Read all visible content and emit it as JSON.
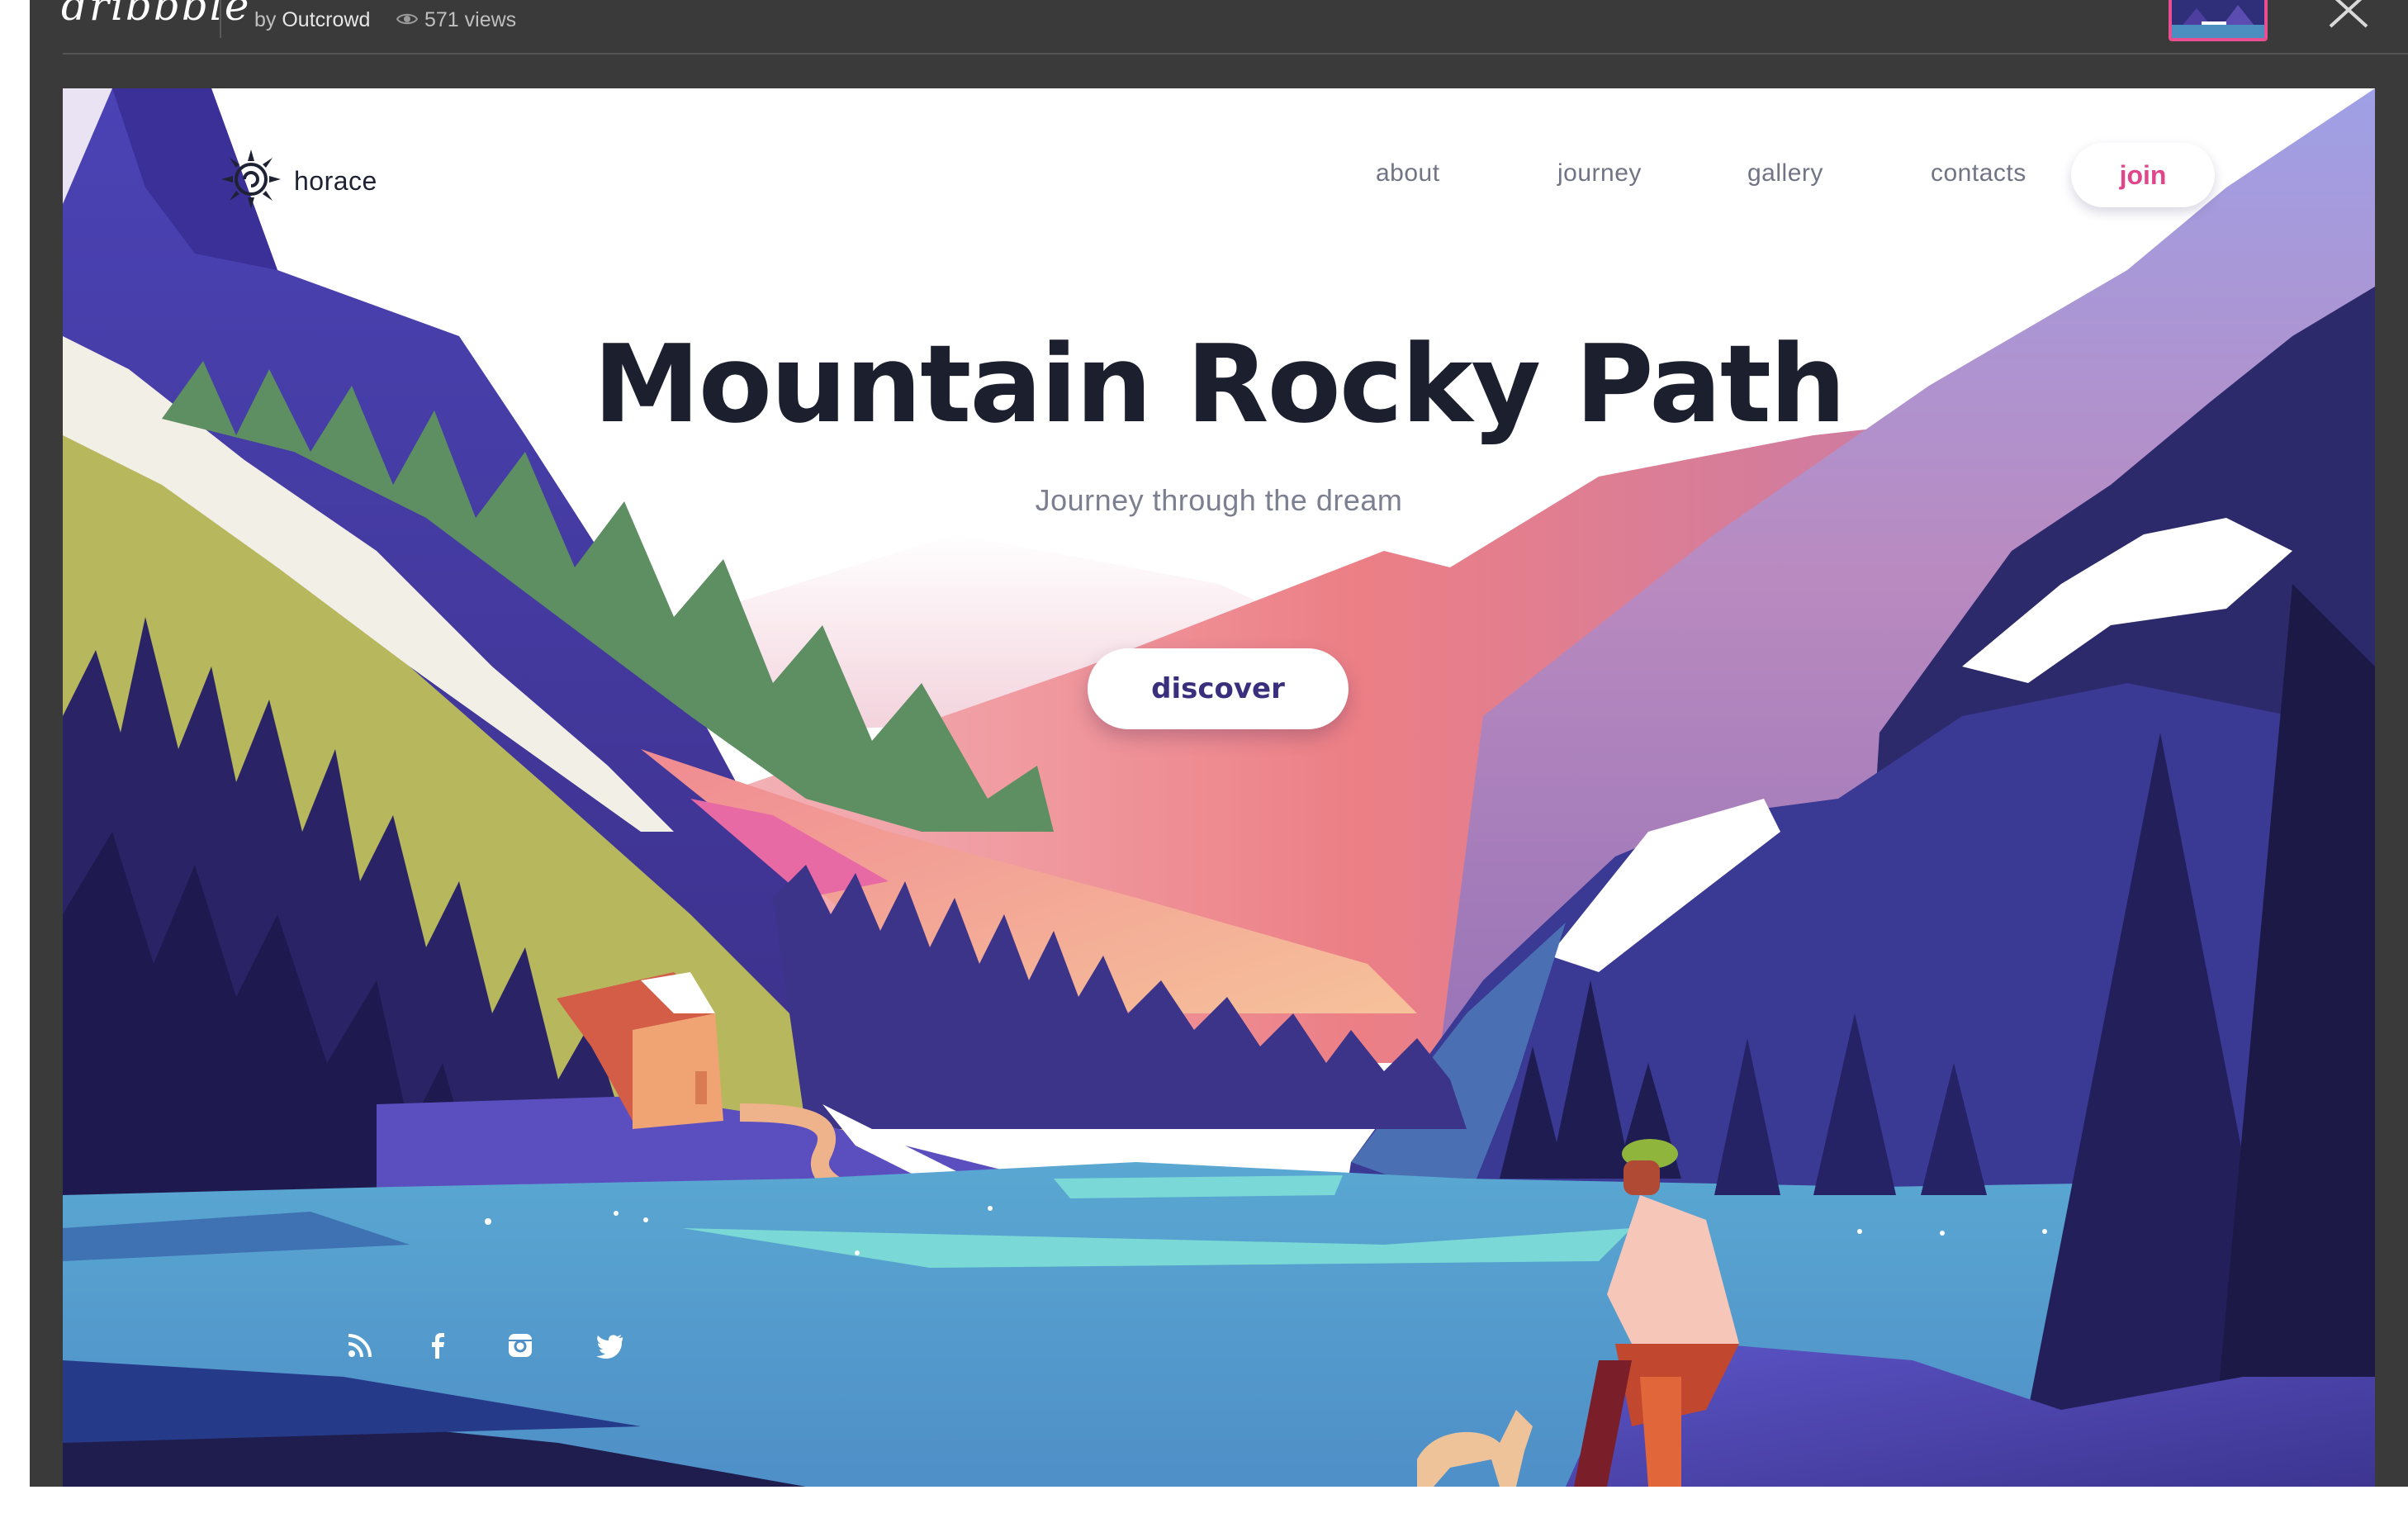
{
  "viewer": {
    "brand": "dribbble",
    "by_prefix": "by",
    "author": "Outcrowd",
    "views": "571 views",
    "icons": {
      "views": "eye-icon",
      "close": "close-icon"
    }
  },
  "site": {
    "logo_text": "horace",
    "logo_icon": "sun-spiral-icon",
    "nav": [
      {
        "label": "about"
      },
      {
        "label": "journey"
      },
      {
        "label": "gallery"
      },
      {
        "label": "contacts"
      }
    ],
    "join_label": "join",
    "hero": {
      "title": "Mountain Rocky Path",
      "subtitle": "Journey through the dream",
      "cta": "discover"
    },
    "social": [
      "rss-icon",
      "facebook-icon",
      "instagram-icon",
      "twitter-icon"
    ]
  },
  "colors": {
    "viewer_bg": "#3a3a3a",
    "accent_pink": "#e0478a",
    "title_dark": "#1c1f2e",
    "cta_text": "#3a2f7d",
    "lake": "#559fc9",
    "lake_highlight": "#7ad9d6",
    "mountain_coral": "#ec8285",
    "mountain_purple": "#3f3a8e"
  }
}
